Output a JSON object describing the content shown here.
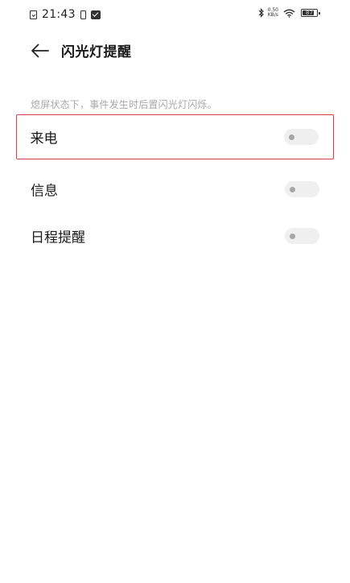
{
  "status_bar": {
    "time": "21:43",
    "net_speed_value": "0.50",
    "net_speed_unit": "KB/s",
    "battery": "87"
  },
  "header": {
    "title": "闪光灯提醒"
  },
  "description": "熄屏状态下，事件发生时后置闪光灯闪烁。",
  "settings": [
    {
      "label": "来电",
      "enabled": false
    },
    {
      "label": "信息",
      "enabled": false
    },
    {
      "label": "日程提醒",
      "enabled": false
    }
  ],
  "colors": {
    "highlight_border": "#d9414a",
    "toggle_track_off": "#efefef",
    "toggle_knob_off": "#a6a6a6",
    "description_text": "#a8a8a8"
  }
}
